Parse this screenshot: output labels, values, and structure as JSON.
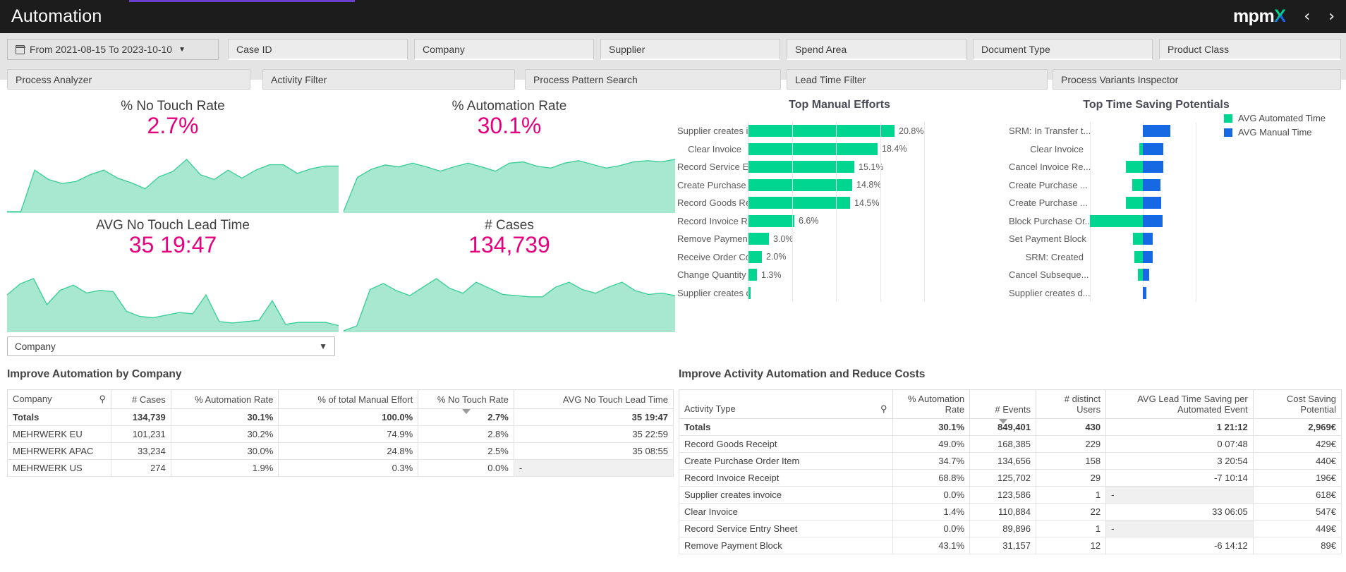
{
  "header": {
    "title": "Automation",
    "logo_main": "mpm",
    "logo_x": "X",
    "prev_icon": "‹",
    "next_icon": "›"
  },
  "filters": {
    "date_range": "From 2021-08-15 To 2023-10-10",
    "fields": [
      {
        "name": "case-id",
        "placeholder": "Case ID",
        "value": ""
      },
      {
        "name": "company",
        "placeholder": "Company",
        "value": ""
      },
      {
        "name": "supplier",
        "placeholder": "Supplier",
        "value": ""
      },
      {
        "name": "spend-area",
        "placeholder": "Spend Area",
        "value": ""
      },
      {
        "name": "document-type",
        "placeholder": "Document Type",
        "value": ""
      },
      {
        "name": "product-class",
        "placeholder": "Product Class",
        "value": ""
      }
    ],
    "buttons": [
      "Process Analyzer",
      "Activity Filter",
      "Process Pattern Search",
      "Lead Time Filter",
      "Process Variants Inspector"
    ]
  },
  "kpis": [
    {
      "label": "% No Touch Rate",
      "value": "2.7%"
    },
    {
      "label": "% Automation Rate",
      "value": "30.1%"
    },
    {
      "label": "AVG No Touch Lead Time",
      "value": "35 19:47"
    },
    {
      "label": "# Cases",
      "value": "134,739"
    }
  ],
  "dimension_selector": {
    "value": "Company",
    "caret": "▼"
  },
  "chart_data": [
    {
      "type": "bar",
      "title": "Top Manual Efforts",
      "orientation": "horizontal",
      "categories": [
        "Supplier creates i...",
        "Clear Invoice",
        "Record Service En...",
        "Create Purchase ...",
        "Record Goods Re...",
        "Record Invoice Re...",
        "Remove Payment ...",
        "Receive Order Con...",
        "Change Quantity",
        "Supplier creates d..."
      ],
      "values": [
        20.8,
        18.4,
        15.1,
        14.8,
        14.5,
        6.6,
        3.0,
        2.0,
        1.3,
        0.4
      ],
      "value_labels": [
        "20.8%",
        "18.4%",
        "15.1%",
        "14.8%",
        "14.5%",
        "6.6%",
        "3.0%",
        "2.0%",
        "1.3%",
        ""
      ],
      "xlabel": "",
      "ylabel": "",
      "xlim": [
        0,
        25
      ],
      "grid": true,
      "series_color": "#00d68f"
    },
    {
      "type": "bar",
      "title": "Top Time Saving Potentials",
      "orientation": "horizontal",
      "grouping": "diverging",
      "categories": [
        "SRM: In Transfer t...",
        "Clear Invoice",
        "Cancel Invoice Re...",
        "Create Purchase ...",
        "Create Purchase ...",
        "Block Purchase Or...",
        "Set Payment Block",
        "SRM: Created",
        "Cancel Subseque...",
        "Supplier creates d..."
      ],
      "series": [
        {
          "name": "AVG Automated Time",
          "color": "#00d68f",
          "values": [
            0.0,
            4.0,
            19.0,
            12.0,
            19.0,
            60.0,
            11.0,
            10.0,
            6.0,
            0.0
          ]
        },
        {
          "name": "AVG Manual Time",
          "color": "#1668e3",
          "values": [
            31.0,
            23.0,
            23.0,
            20.0,
            21.0,
            22.0,
            11.0,
            11.0,
            7.0,
            4.0
          ]
        }
      ],
      "legend_position": "right",
      "grid": true
    }
  ],
  "left_table": {
    "title": "Improve Automation by Company",
    "search_icon": "search-icon",
    "columns": [
      "Company",
      "# Cases",
      "% Automation Rate",
      "% of total Manual Effort",
      "% No Touch Rate",
      "AVG No Touch Lead Time"
    ],
    "sorted_column_index": 4,
    "totals": [
      "Totals",
      "134,739",
      "30.1%",
      "100.0%",
      "2.7%",
      "35 19:47"
    ],
    "rows": [
      [
        "MEHRWERK EU",
        "101,231",
        "30.2%",
        "74.9%",
        "2.8%",
        "35 22:59"
      ],
      [
        "MEHRWERK APAC",
        "33,234",
        "30.0%",
        "24.8%",
        "2.5%",
        "35 08:55"
      ],
      [
        "MEHRWERK US",
        "274",
        "1.9%",
        "0.3%",
        "0.0%",
        "-"
      ]
    ]
  },
  "right_table": {
    "title": "Improve Activity Automation and Reduce Costs",
    "search_icon": "search-icon",
    "columns": [
      "Activity Type",
      "% Automation Rate",
      "# Events",
      "# distinct Users",
      "AVG Lead Time Saving per Automated Event",
      "Cost Saving Potential"
    ],
    "sorted_column_index": 2,
    "totals": [
      "Totals",
      "30.1%",
      "849,401",
      "430",
      "1 21:12",
      "2,969€"
    ],
    "rows": [
      [
        "Record Goods Receipt",
        "49.0%",
        "168,385",
        "229",
        "0 07:48",
        "429€"
      ],
      [
        "Create Purchase Order Item",
        "34.7%",
        "134,656",
        "158",
        "3 20:54",
        "440€"
      ],
      [
        "Record Invoice Receipt",
        "68.8%",
        "125,702",
        "29",
        "-7 10:14",
        "196€"
      ],
      [
        "Supplier creates invoice",
        "0.0%",
        "123,586",
        "1",
        "-",
        "618€"
      ],
      [
        "Clear Invoice",
        "1.4%",
        "110,884",
        "22",
        "33 06:05",
        "547€"
      ],
      [
        "Record Service Entry Sheet",
        "0.0%",
        "89,896",
        "1",
        "-",
        "449€"
      ],
      [
        "Remove Payment Block",
        "43.1%",
        "31,157",
        "12",
        "-6 14:12",
        "89€"
      ]
    ],
    "empty_cells": [
      [
        3,
        4
      ],
      [
        5,
        4
      ]
    ]
  },
  "sparklines": {
    "no_touch_rate": [
      0,
      0,
      62,
      48,
      42,
      45,
      55,
      62,
      50,
      43,
      34,
      52,
      60,
      78,
      55,
      48,
      62,
      50,
      62,
      70,
      70,
      57,
      64,
      68,
      68
    ],
    "automation_rate": [
      0,
      55,
      68,
      75,
      72,
      78,
      72,
      65,
      72,
      78,
      72,
      65,
      78,
      80,
      73,
      70,
      78,
      82,
      76,
      70,
      74,
      80,
      82,
      80,
      84
    ],
    "no_touch_lead": [
      55,
      72,
      80,
      40,
      62,
      70,
      58,
      62,
      60,
      30,
      22,
      20,
      24,
      28,
      26,
      55,
      14,
      12,
      14,
      16,
      46,
      10,
      13,
      13,
      13,
      8
    ],
    "cases": [
      0,
      8,
      68,
      78,
      66,
      58,
      72,
      86,
      70,
      62,
      80,
      70,
      60,
      58,
      56,
      56,
      72,
      80,
      68,
      62,
      72,
      80,
      66,
      60,
      62,
      58
    ]
  },
  "colors": {
    "accent_pink": "#e6007e",
    "green": "#00d68f",
    "blue": "#1668e3",
    "spark_fill": "#a8e8d0",
    "header_bg": "#1c1c1c"
  }
}
